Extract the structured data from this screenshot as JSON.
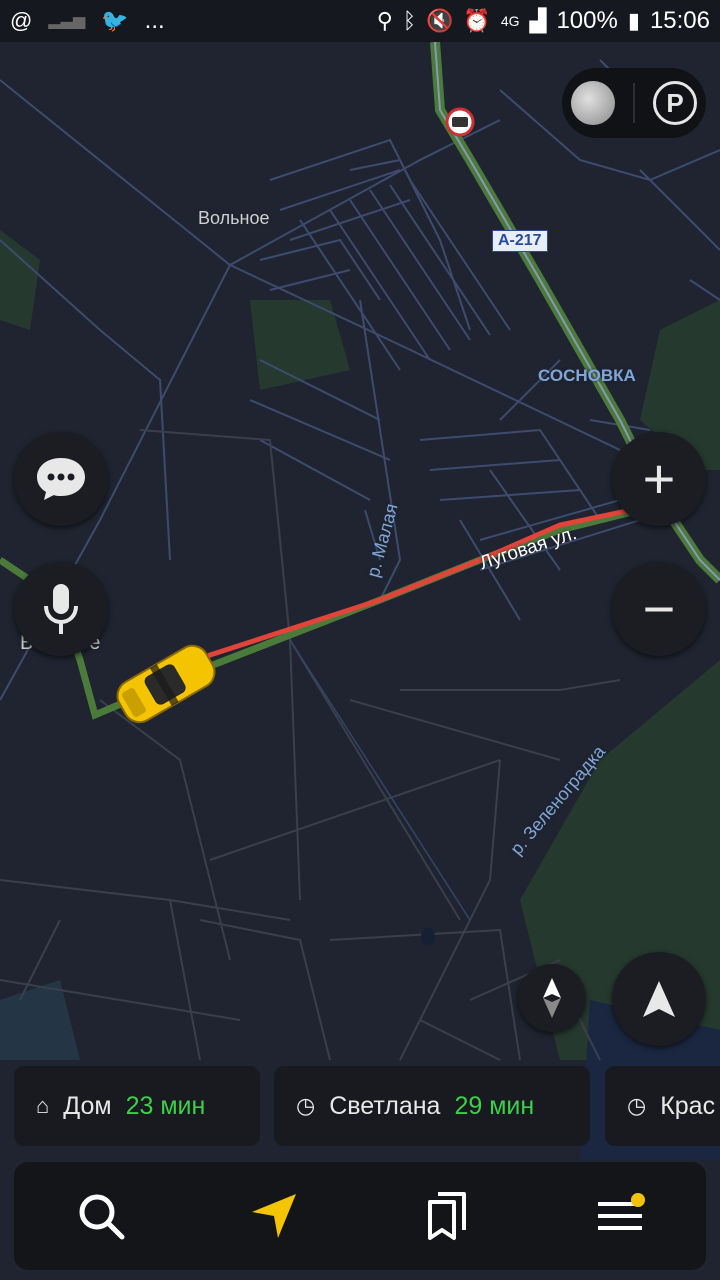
{
  "status_bar": {
    "left_icons": [
      "at-icon",
      "signal-bars-icon",
      "twitter-icon"
    ],
    "ellipsis": "...",
    "right_icons": [
      "location-icon",
      "bluetooth-icon",
      "mute-icon",
      "alarm-icon",
      "4g-icon",
      "signal-icon"
    ],
    "network_label": "4G",
    "battery": "100%",
    "time": "15:06"
  },
  "map": {
    "labels": {
      "volnoe": "Вольное",
      "a217": "А-217",
      "sosnovka": "СОСНОВКА",
      "malaya": "р. Малая",
      "lugovaya": "Луговая ул.",
      "verbnoe": "Вербное",
      "zelenogradka": "р. Зеленоградка"
    },
    "colors": {
      "background": "#1f2430",
      "road": "#3d4b6e",
      "highway": "#4b7b3a",
      "route": "#e0443a",
      "forest": "#26392f"
    }
  },
  "controls": {
    "layers_icon": "layers-circle-icon",
    "parking_label": "P",
    "zoom_in": "+",
    "zoom_out": "−"
  },
  "destinations": [
    {
      "icon": "home-icon",
      "name": "Дом",
      "time": "23 мин"
    },
    {
      "icon": "clock-icon",
      "name": "Светлана",
      "time": "29 мин"
    },
    {
      "icon": "clock-icon",
      "name": "Крас",
      "time": ""
    }
  ],
  "bottom_nav": {
    "items": [
      "search-icon",
      "navigate-arrow-icon",
      "bookmarks-icon",
      "menu-icon"
    ],
    "accent": "#f5c400"
  }
}
